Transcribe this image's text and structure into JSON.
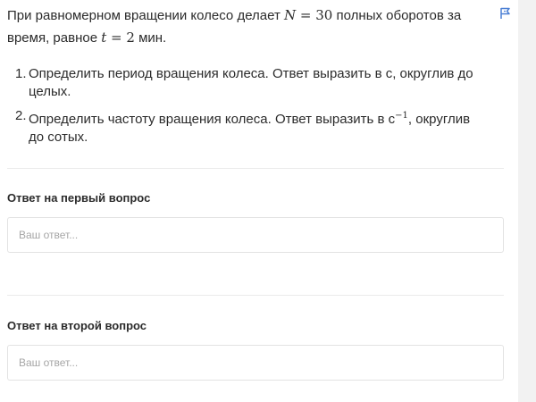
{
  "problem": {
    "text_1": "При равномерном вращении колесо делает ",
    "var_n": "N",
    "eq_n": " = ",
    "value_n": "30",
    "text_2": " полных оборотов за время, равное ",
    "var_t": "t",
    "eq_t": " = ",
    "value_t": "2",
    "text_3": " мин."
  },
  "tasks": [
    {
      "number": "1.",
      "text": "Определить период вращения колеса. Ответ выразить в с, округлив до целых."
    },
    {
      "number": "2.",
      "text_before": "Определить частоту вращения колеса. Ответ выразить в с",
      "superscript": "−1",
      "text_after": ", округлив до сотых."
    }
  ],
  "answers": [
    {
      "label": "Ответ на первый вопрос",
      "placeholder": "Ваш ответ...",
      "value": ""
    },
    {
      "label": "Ответ на второй вопрос",
      "placeholder": "Ваш ответ...",
      "value": ""
    }
  ],
  "icons": {
    "report": "flag-icon"
  },
  "colors": {
    "icon_accent": "#4a7fd4",
    "divider": "#eaeaea",
    "placeholder": "#a6a6a6"
  }
}
